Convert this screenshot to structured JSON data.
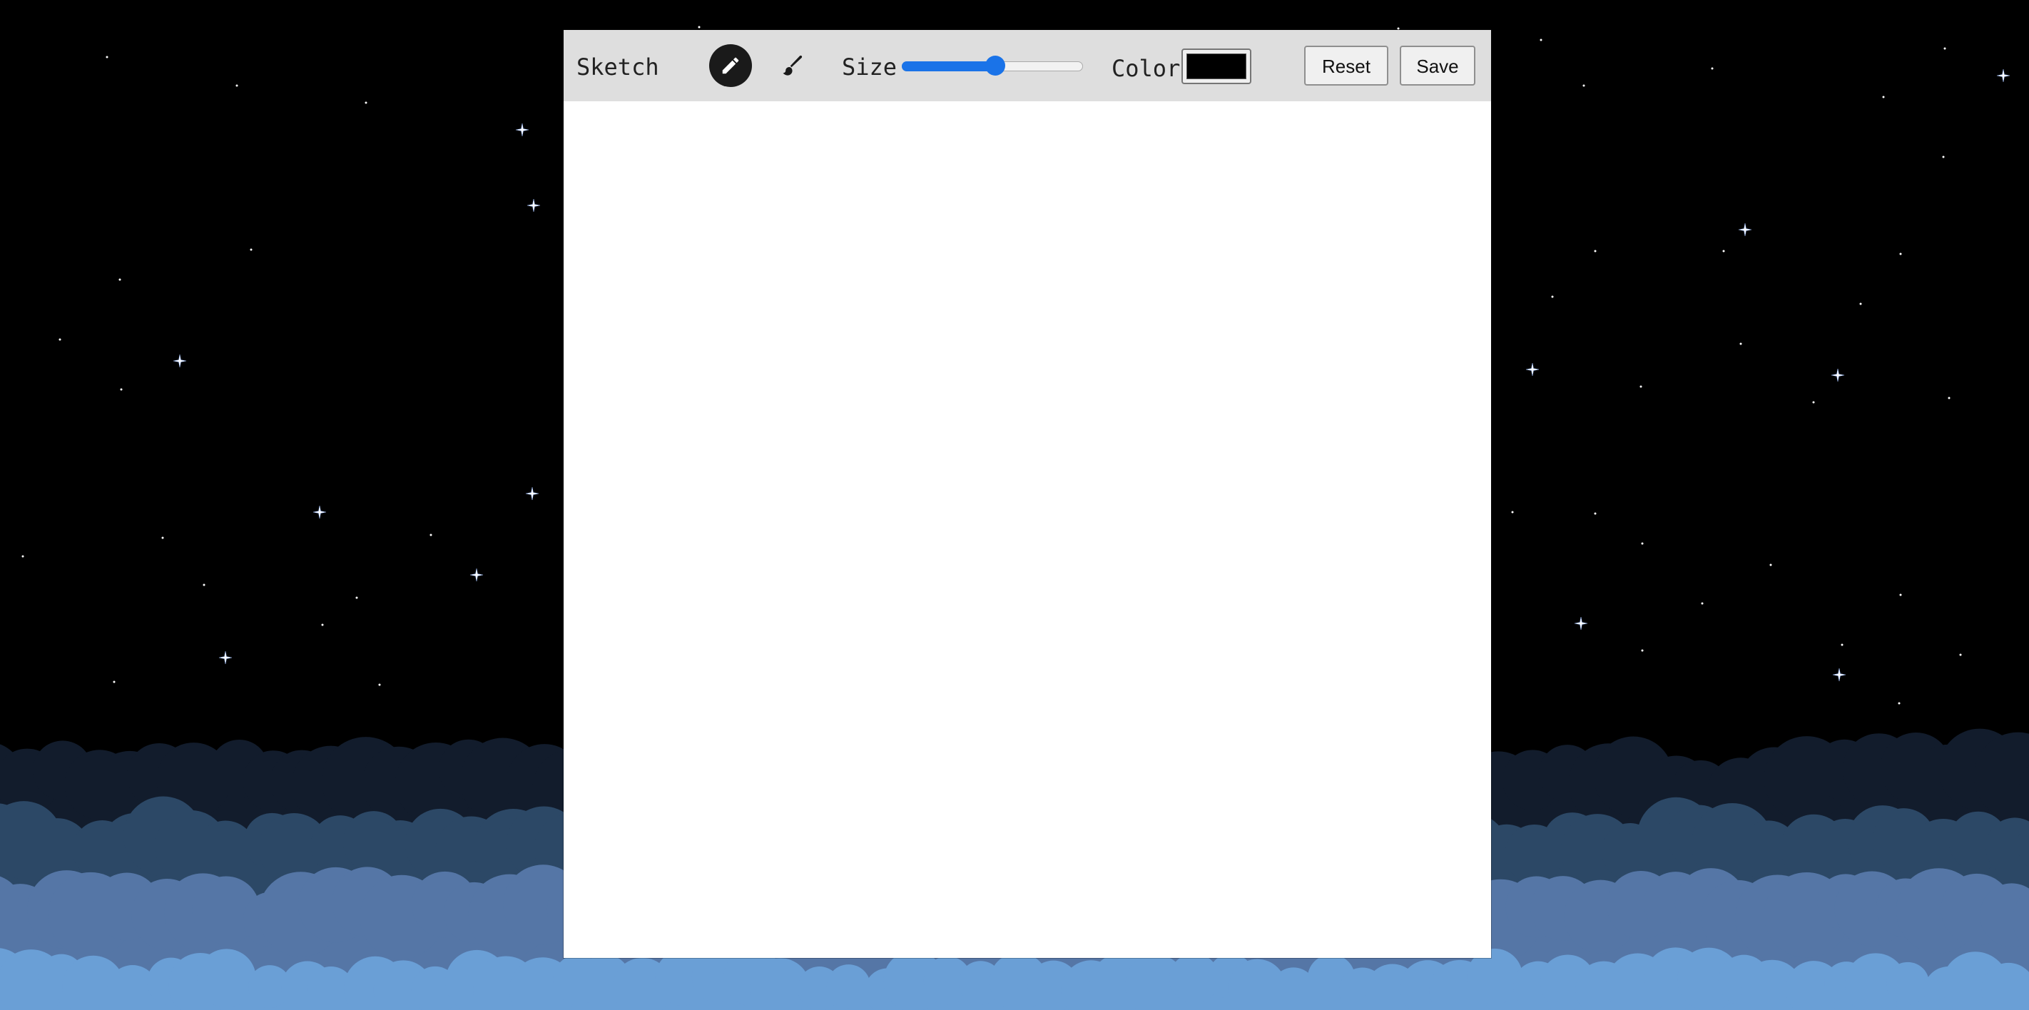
{
  "app": {
    "title": "Sketch",
    "size_label": "Size",
    "color_label": "Color",
    "size_value": 0.52,
    "color_value": "#000000",
    "reset_label": "Reset",
    "save_label": "Save",
    "tools": [
      {
        "name": "pencil",
        "icon": "pencil-icon",
        "active": true
      },
      {
        "name": "brush",
        "icon": "brush-icon",
        "active": false
      }
    ]
  },
  "colors": {
    "sky": "#000000",
    "star": "#ffffff",
    "star_glow": "#a9c6ff",
    "cloud_back": "#121c2c",
    "cloud_mid": "#2c4866",
    "cloud_front": "#5576a6",
    "cloud_bright": "#6a9fd6",
    "accent": "#1a73e8",
    "toolbar": "#dedede"
  }
}
